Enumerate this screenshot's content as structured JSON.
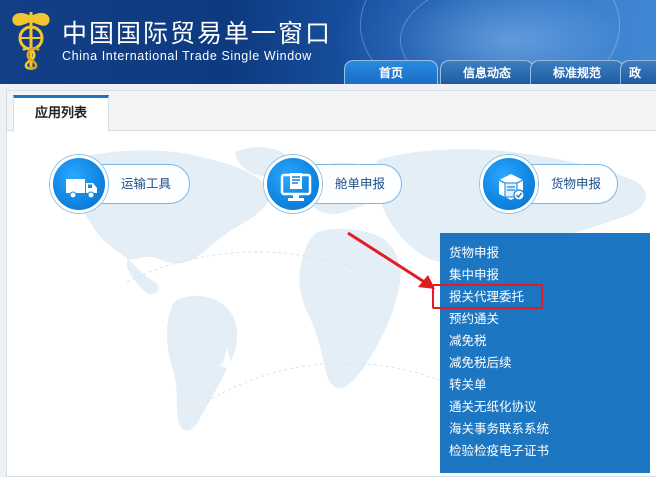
{
  "header": {
    "title_cn": "中国国际贸易单一窗口",
    "title_en": "China International Trade Single  Window"
  },
  "nav": {
    "tabs": [
      {
        "label": "首页",
        "active": true
      },
      {
        "label": "信息动态",
        "active": false
      },
      {
        "label": "标准规范",
        "active": false
      },
      {
        "label": "政",
        "active": false
      }
    ]
  },
  "panel": {
    "tab_label": "应用列表"
  },
  "apps": [
    {
      "label": "运输工具",
      "icon": "truck-icon"
    },
    {
      "label": "舱单申报",
      "icon": "monitor-document-icon"
    },
    {
      "label": "货物申报",
      "icon": "package-checklist-icon"
    }
  ],
  "dropdown": {
    "items": [
      "货物申报",
      "集中申报",
      "报关代理委托",
      "预约通关",
      "减免税",
      "减免税后续",
      "转关单",
      "通关无纸化协议",
      "海关事务联系系统",
      "检验检疫电子证书"
    ],
    "highlighted_index": 2
  },
  "colors": {
    "header_blue": "#123f86",
    "accent_blue": "#1677c8",
    "dropdown_bg": "#1d76c2",
    "highlight_red": "#e31b23"
  }
}
